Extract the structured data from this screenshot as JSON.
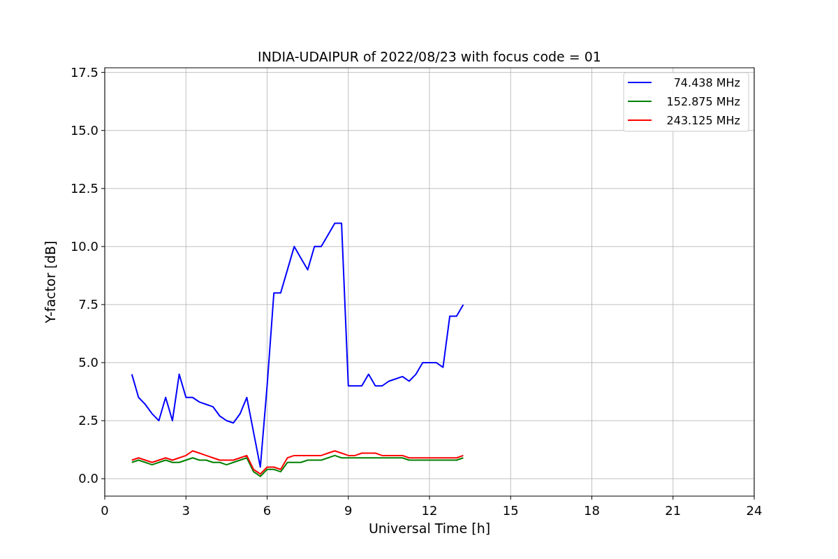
{
  "figure": {
    "chart_data": {
      "type": "line",
      "title": "INDIA-UDAIPUR of 2022/08/23 with focus code = 01",
      "xlabel": "Universal Time [h]",
      "ylabel": "Y-factor [dB]",
      "x": [
        1.0,
        1.25,
        1.5,
        1.75,
        2.0,
        2.25,
        2.5,
        2.75,
        3.0,
        3.25,
        3.5,
        3.75,
        4.0,
        4.25,
        4.5,
        4.75,
        5.0,
        5.25,
        5.5,
        5.75,
        6.0,
        6.25,
        6.5,
        6.75,
        7.0,
        7.25,
        7.5,
        7.75,
        8.0,
        8.25,
        8.5,
        8.75,
        9.0,
        9.25,
        9.5,
        9.75,
        10.0,
        10.25,
        10.5,
        10.75,
        11.0,
        11.25,
        11.5,
        11.75,
        12.0,
        12.25,
        12.5,
        12.75,
        13.0,
        13.25
      ],
      "series": [
        {
          "name": "74.438 MHz",
          "color": "#0000ff",
          "values": [
            4.5,
            3.5,
            3.2,
            2.8,
            2.5,
            3.5,
            2.5,
            4.5,
            3.5,
            3.5,
            3.3,
            3.2,
            3.1,
            2.7,
            2.5,
            2.4,
            2.8,
            3.5,
            2.0,
            0.5,
            4.0,
            8.0,
            8.0,
            9.0,
            10.0,
            9.5,
            9.0,
            10.0,
            10.0,
            10.5,
            11.0,
            11.0,
            4.0,
            4.0,
            4.0,
            4.5,
            4.0,
            4.0,
            4.2,
            4.3,
            4.4,
            4.2,
            4.5,
            5.0,
            5.0,
            5.0,
            4.8,
            7.0,
            7.0,
            7.5
          ]
        },
        {
          "name": "152.875 MHz",
          "color": "#008000",
          "values": [
            0.7,
            0.8,
            0.7,
            0.6,
            0.7,
            0.8,
            0.7,
            0.7,
            0.8,
            0.9,
            0.8,
            0.8,
            0.7,
            0.7,
            0.6,
            0.7,
            0.8,
            0.9,
            0.3,
            0.1,
            0.4,
            0.4,
            0.3,
            0.7,
            0.7,
            0.7,
            0.8,
            0.8,
            0.8,
            0.9,
            1.0,
            0.9,
            0.9,
            0.9,
            0.9,
            0.9,
            0.9,
            0.9,
            0.9,
            0.9,
            0.9,
            0.8,
            0.8,
            0.8,
            0.8,
            0.8,
            0.8,
            0.8,
            0.8,
            0.9
          ]
        },
        {
          "name": "243.125 MHz",
          "color": "#ff0000",
          "values": [
            0.8,
            0.9,
            0.8,
            0.7,
            0.8,
            0.9,
            0.8,
            0.9,
            1.0,
            1.2,
            1.1,
            1.0,
            0.9,
            0.8,
            0.8,
            0.8,
            0.9,
            1.0,
            0.4,
            0.2,
            0.5,
            0.5,
            0.4,
            0.9,
            1.0,
            1.0,
            1.0,
            1.0,
            1.0,
            1.1,
            1.2,
            1.1,
            1.0,
            1.0,
            1.1,
            1.1,
            1.1,
            1.0,
            1.0,
            1.0,
            1.0,
            0.9,
            0.9,
            0.9,
            0.9,
            0.9,
            0.9,
            0.9,
            0.9,
            1.0
          ]
        }
      ],
      "grid": true,
      "legend": true,
      "xlim": [
        0,
        24
      ],
      "ylim": [
        -0.75,
        17.7
      ],
      "xticks": [
        0,
        3,
        6,
        9,
        12,
        15,
        18,
        21,
        24
      ],
      "yticks": [
        {
          "value": 0,
          "label": "0.0"
        },
        {
          "value": 2.5,
          "label": "2.5"
        },
        {
          "value": 5,
          "label": "5.0"
        },
        {
          "value": 7.5,
          "label": "7.5"
        },
        {
          "value": 10,
          "label": "10.0"
        },
        {
          "value": 12.5,
          "label": "12.5"
        },
        {
          "value": 15,
          "label": "15.0"
        },
        {
          "value": 17.5,
          "label": "17.5"
        }
      ]
    }
  }
}
